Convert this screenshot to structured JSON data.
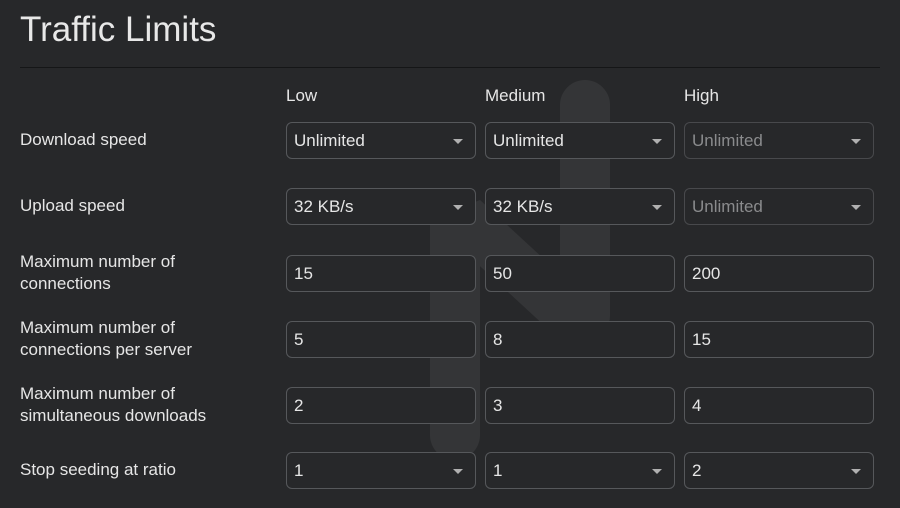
{
  "title": "Traffic Limits",
  "columns": [
    "Low",
    "Medium",
    "High"
  ],
  "rows": [
    {
      "label": "Download speed",
      "type": "select",
      "values": [
        "Unlimited",
        "Unlimited",
        "Unlimited"
      ],
      "disabled": [
        false,
        false,
        true
      ]
    },
    {
      "label": "Upload speed",
      "type": "select",
      "values": [
        "32 KB/s",
        "32 KB/s",
        "Unlimited"
      ],
      "disabled": [
        false,
        false,
        true
      ]
    },
    {
      "label": "Maximum number of connections",
      "type": "input",
      "values": [
        "15",
        "50",
        "200"
      ]
    },
    {
      "label": "Maximum number of connections per server",
      "type": "input",
      "values": [
        "5",
        "8",
        "15"
      ]
    },
    {
      "label": "Maximum number of simultaneous downloads",
      "type": "input",
      "values": [
        "2",
        "3",
        "4"
      ]
    },
    {
      "label": "Stop seeding at ratio",
      "type": "select",
      "values": [
        "1",
        "1",
        "2"
      ],
      "disabled": [
        false,
        false,
        false
      ]
    }
  ],
  "colors": {
    "background": "#27282a",
    "border": "#56585b",
    "text": "#e6e6e6",
    "disabled_text": "#8a8b8d"
  }
}
